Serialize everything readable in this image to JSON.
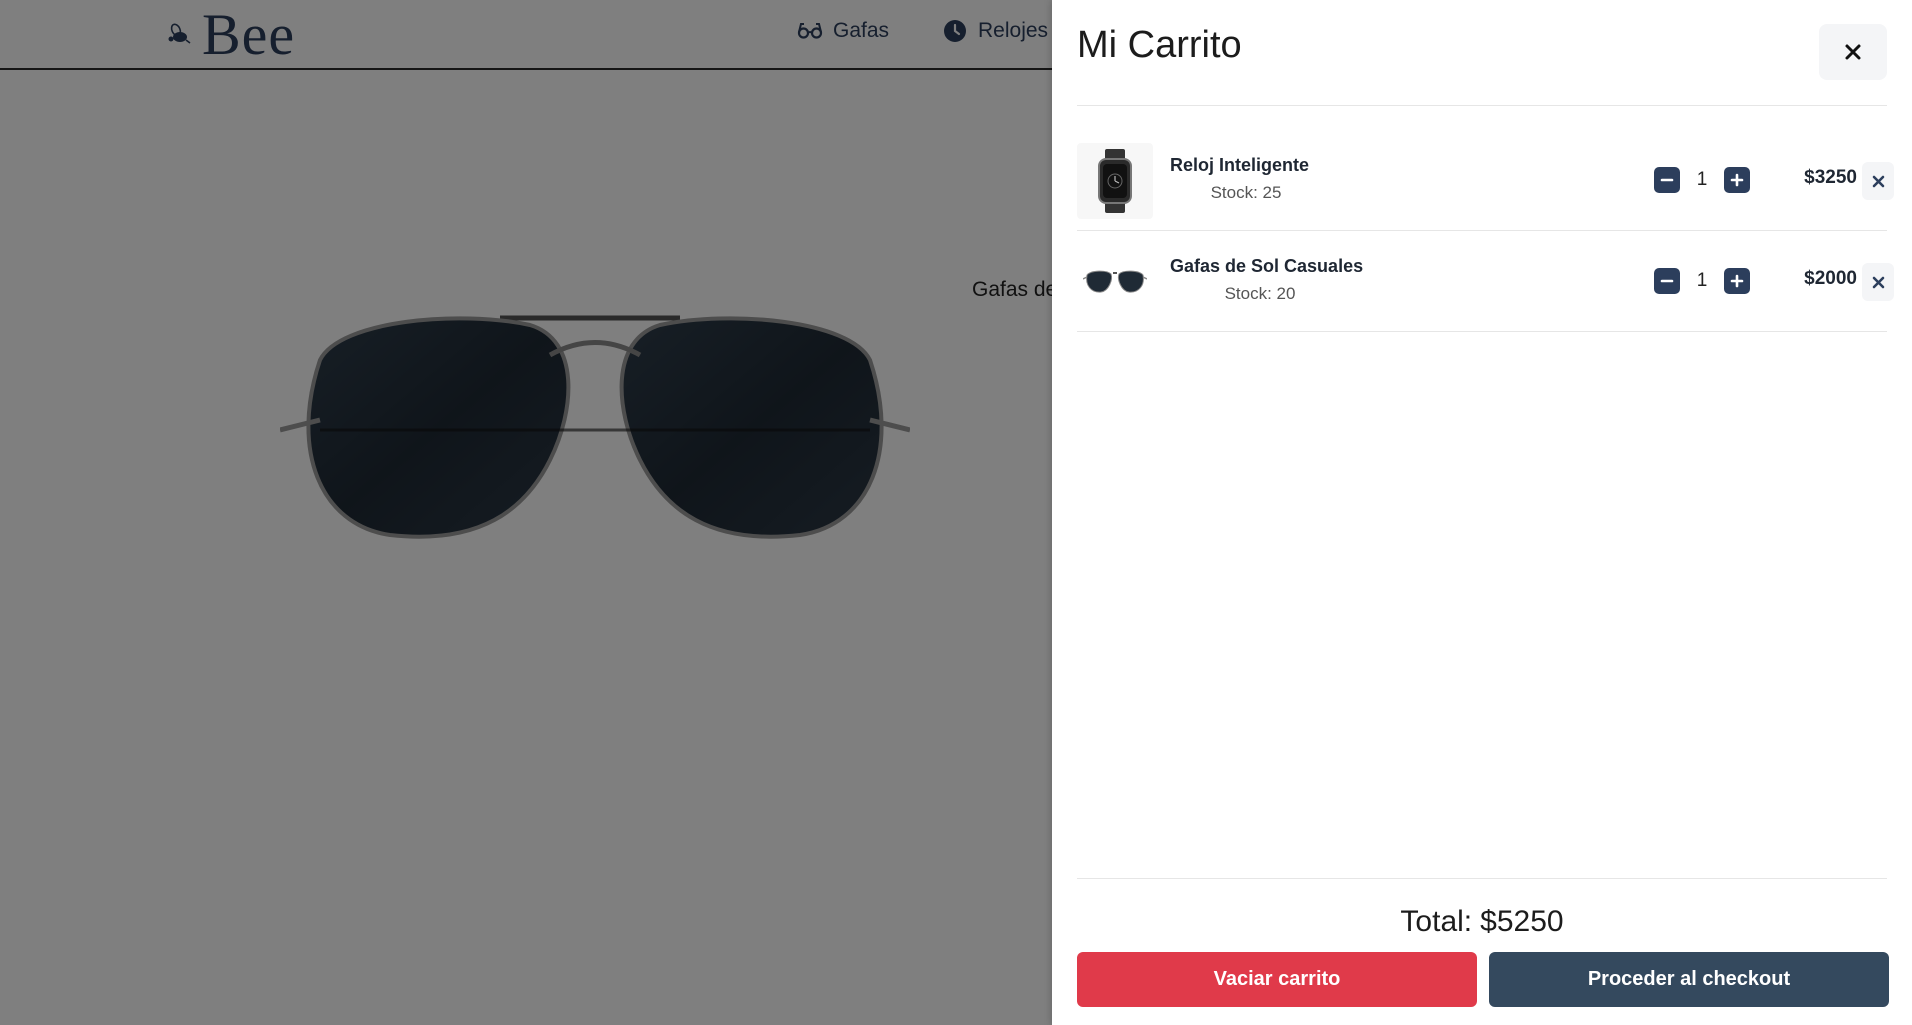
{
  "header": {
    "logo_text": "Bee",
    "nav": [
      {
        "label": "Gafas",
        "icon": "glasses-icon"
      },
      {
        "label": "Relojes",
        "icon": "clock-icon"
      }
    ]
  },
  "hero": {
    "title_fragment": "Gafas de",
    "image": "aviator-sunglasses"
  },
  "cart": {
    "title": "Mi Carrito",
    "close_icon": "close-icon",
    "items": [
      {
        "name": "Reloj Inteligente",
        "stock": "Stock: 25",
        "quantity": "1",
        "price": "$3250",
        "thumb": "smartwatch-image"
      },
      {
        "name": "Gafas de Sol Casuales",
        "stock": "Stock: 20",
        "quantity": "1",
        "price": "$2000",
        "thumb": "sunglasses-image"
      }
    ],
    "total_label": "Total:",
    "total_value": "$5250",
    "clear_label": "Vaciar carrito",
    "checkout_label": "Proceder al checkout"
  },
  "colors": {
    "brand": "#2c3e5c",
    "danger": "#e03a4a",
    "checkout": "#34495e",
    "overlay": "rgba(0,0,0,0.5)"
  }
}
